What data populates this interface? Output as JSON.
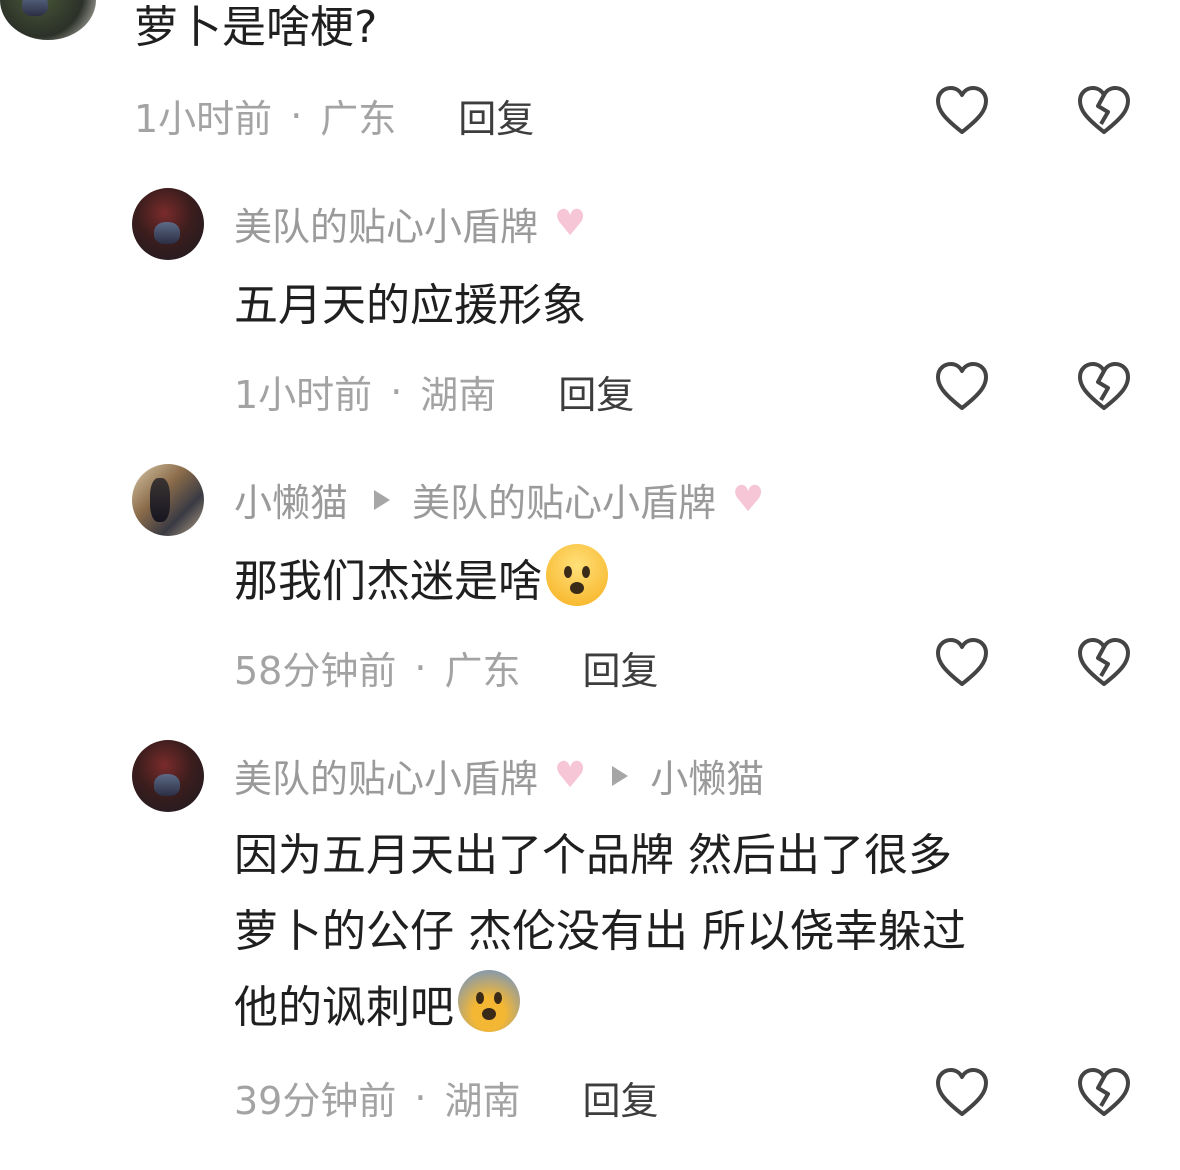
{
  "comments": [
    {
      "text": "萝卜是啥梗?",
      "time": "1小时前",
      "location": "广东",
      "reply_label": "回复"
    },
    {
      "author": "美队的贴心小盾牌",
      "text": "五月天的应援形象",
      "time": "1小时前",
      "location": "湖南",
      "reply_label": "回复"
    },
    {
      "author": "小懒猫",
      "reply_to": "美队的贴心小盾牌",
      "text": "那我们杰迷是啥",
      "time": "58分钟前",
      "location": "广东",
      "reply_label": "回复"
    },
    {
      "author": "美队的贴心小盾牌",
      "reply_to": "小懒猫",
      "lines": [
        "因为五月天出了个品牌 然后出了很多",
        "萝卜的公仔  杰伦没有出 所以侥幸躲过",
        "他的讽刺吧"
      ],
      "time": "39分钟前",
      "location": "湖南",
      "reply_label": "回复"
    }
  ],
  "separator": "·",
  "icons": {
    "like": "heart-outline-icon",
    "dislike": "broken-heart-icon",
    "badge": "pink-heart-icon"
  },
  "colors": {
    "name": "#9a9a9a",
    "text": "#1f1f1f",
    "meta": "#a3a3a3",
    "badge": "#f6c6d6"
  }
}
